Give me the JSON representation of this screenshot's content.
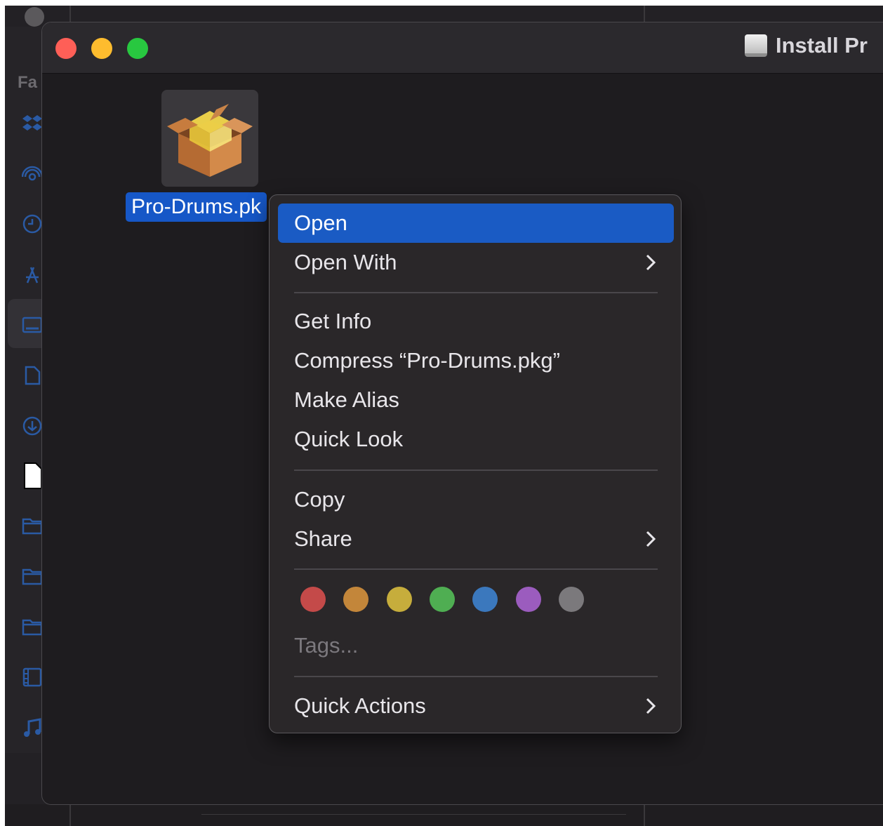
{
  "background": {
    "sidebar_title": "Fa"
  },
  "window": {
    "title": "Install Pr",
    "title_icon": "disk-image-icon"
  },
  "file": {
    "name": "Pro-Drums.pk",
    "icon": "package-icon"
  },
  "context_menu": {
    "open": "Open",
    "open_with": "Open With",
    "get_info": "Get Info",
    "compress": "Compress “Pro-Drums.pkg”",
    "make_alias": "Make Alias",
    "quick_look": "Quick Look",
    "copy": "Copy",
    "share": "Share",
    "tags_placeholder": "Tags...",
    "quick_actions": "Quick Actions",
    "submenu_chevron": ">",
    "tag_colors": [
      {
        "name": "red",
        "color": "#c44a49"
      },
      {
        "name": "orange",
        "color": "#c3863a"
      },
      {
        "name": "yellow",
        "color": "#c6ad3c"
      },
      {
        "name": "green",
        "color": "#4fae52"
      },
      {
        "name": "blue",
        "color": "#3b78bd"
      },
      {
        "name": "purple",
        "color": "#9b5cbe"
      },
      {
        "name": "gray",
        "color": "#7b797c"
      }
    ]
  }
}
